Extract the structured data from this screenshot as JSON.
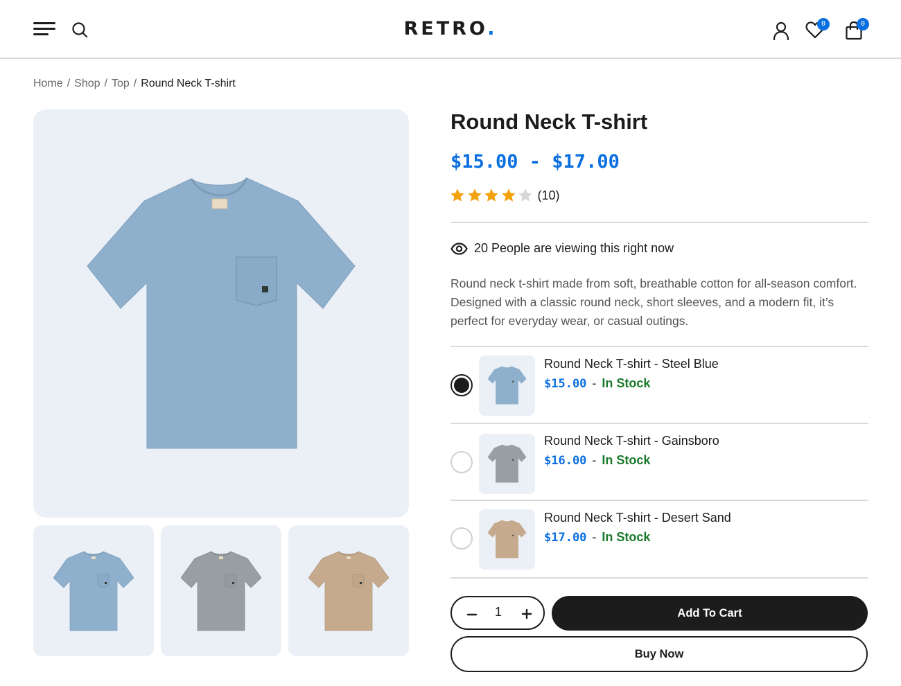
{
  "header": {
    "logo_text": "RETRO",
    "logo_dot": ".",
    "wishlist_count": "0",
    "cart_count": "0",
    "icons": [
      "menu-icon",
      "search-icon",
      "user-icon",
      "heart-icon",
      "shopping-bag-icon"
    ]
  },
  "breadcrumb": {
    "items": [
      "Home",
      "Shop",
      "Top"
    ],
    "separator": "/",
    "current": "Round Neck T-shirt"
  },
  "gallery": {
    "thumbnails": [
      {
        "color": "#8fb0cc"
      },
      {
        "color": "#999ea3"
      },
      {
        "color": "#c5aa8d"
      }
    ],
    "main_color": "#8fb0cc"
  },
  "product": {
    "title": "Round Neck T-shirt",
    "price_range": "$15.00 - $17.00",
    "rating": 4,
    "rating_max": 5,
    "rating_count": "(10)",
    "viewing_text": "20 People are viewing this right now",
    "description": "Round neck t-shirt made from soft, breathable cotton for all-season comfort. Designed with a classic round neck, short sleeves, and a modern fit, it’s perfect for everyday wear, or casual outings."
  },
  "variants": [
    {
      "name": "Round Neck T-shirt - Steel Blue",
      "price": "$15.00",
      "dash": "-",
      "stock": "In Stock",
      "selected": true,
      "color": "#8fb0cc"
    },
    {
      "name": "Round Neck T-shirt - Gainsboro",
      "price": "$16.00",
      "dash": "-",
      "stock": "In Stock",
      "selected": false,
      "color": "#999ea3"
    },
    {
      "name": "Round Neck T-shirt - Desert Sand",
      "price": "$17.00",
      "dash": "-",
      "stock": "In Stock",
      "selected": false,
      "color": "#c5aa8d"
    }
  ],
  "actions": {
    "quantity": "1",
    "add_to_cart_label": "Add To Cart",
    "buy_now_label": "Buy Now"
  },
  "colors": {
    "accent": "#0a6fe0",
    "in_stock": "#1a7a2b",
    "star_filled": "#f4a20b",
    "star_empty": "#d6d6d6",
    "image_bg": "#ebf0f7"
  }
}
